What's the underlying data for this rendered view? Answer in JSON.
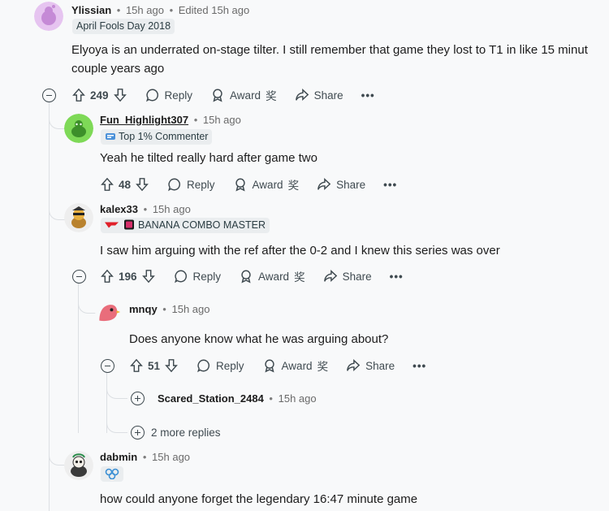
{
  "comments": {
    "c1": {
      "author": "Ylissian",
      "time": "15h ago",
      "edited": "Edited 15h ago",
      "flair": "April Fools Day 2018",
      "body_line1": "Elyoya is an underrated on-stage tilter. I still remember that game they lost to T1 in like 15 minut",
      "body_line2": "couple years ago",
      "score": "249"
    },
    "c2": {
      "author": "Fun_Highlight307",
      "time": "15h ago",
      "flair": "Top 1% Commenter",
      "body": "Yeah he tilted really hard after game two",
      "score": "48"
    },
    "c3": {
      "author": "kalex33",
      "time": "15h ago",
      "flair": "BANANA COMBO MASTER",
      "body": "I saw him arguing with the ref after the 0-2 and I knew this series was over",
      "score": "196"
    },
    "c4": {
      "author": "mnqy",
      "time": "15h ago",
      "body": "Does anyone know what he was arguing about?",
      "score": "51"
    },
    "c5": {
      "author": "Scared_Station_2484",
      "time": "15h ago"
    },
    "more_replies": "2 more replies",
    "c6": {
      "author": "dabmin",
      "time": "15h ago",
      "body": "how could anyone forget the legendary 16:47 minute game"
    }
  },
  "actions": {
    "reply": "Reply",
    "award": "Award",
    "award_glyph": "奖",
    "share": "Share",
    "more": "•••"
  },
  "separator": "•"
}
